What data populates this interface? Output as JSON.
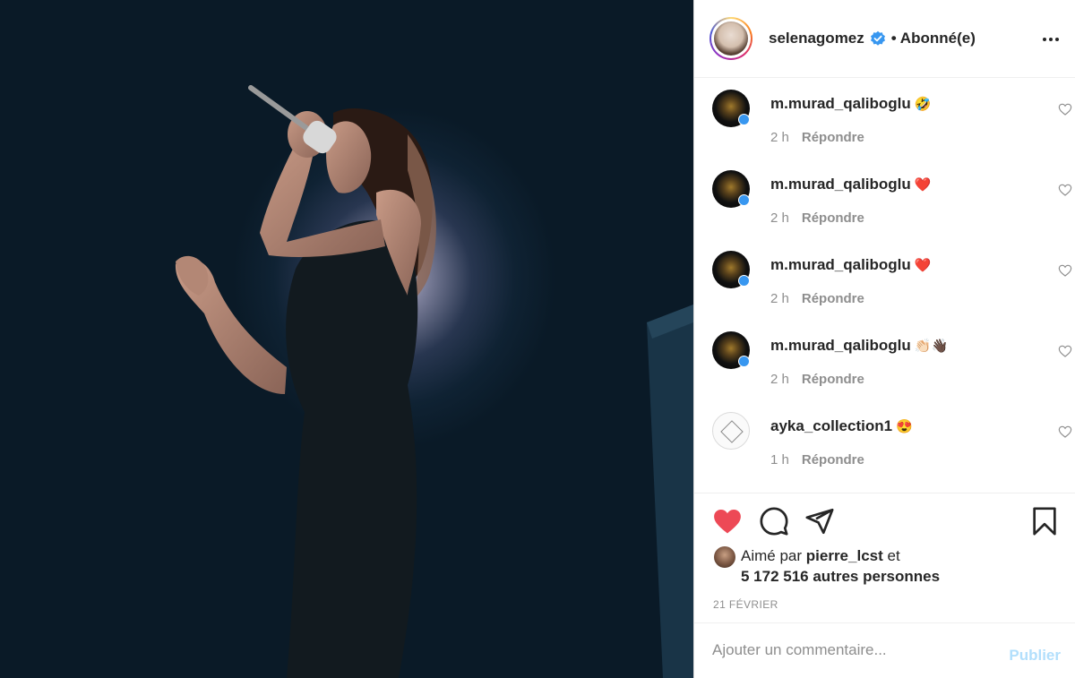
{
  "post": {
    "image_alt": "Concert photo of singer holding microphone on stage"
  },
  "header": {
    "username": "selenagomez",
    "follow_status": "• Abonné(e)",
    "verified": true
  },
  "comments": [
    {
      "user": "m.murad_qaliboglu",
      "emoji": "🤣",
      "time": "2 h",
      "reply": "Répondre",
      "avatar": "dark-logo"
    },
    {
      "user": "m.murad_qaliboglu",
      "emoji": "❤️",
      "time": "2 h",
      "reply": "Répondre",
      "avatar": "dark-logo"
    },
    {
      "user": "m.murad_qaliboglu",
      "emoji": "❤️",
      "time": "2 h",
      "reply": "Répondre",
      "avatar": "dark-logo"
    },
    {
      "user": "m.murad_qaliboglu",
      "emoji": "👏🏻👋🏿",
      "time": "2 h",
      "reply": "Répondre",
      "avatar": "dark-logo"
    },
    {
      "user": "ayka_collection1",
      "emoji": "😍",
      "time": "1 h",
      "reply": "Répondre",
      "avatar": "light-logo"
    }
  ],
  "actions": {
    "liked": true,
    "like_color": "#ed4956",
    "icons": [
      "heart-icon",
      "comment-icon",
      "share-icon",
      "bookmark-icon"
    ]
  },
  "likes": {
    "prefix": "Aimé par",
    "by_user": "pierre_lcst",
    "suffix": "et",
    "others": "5 172 516 autres personnes"
  },
  "date": "21 FÉVRIER",
  "comment_box": {
    "placeholder": "Ajouter un commentaire...",
    "publish_label": "Publier",
    "publish_color": "#b2dffc"
  }
}
